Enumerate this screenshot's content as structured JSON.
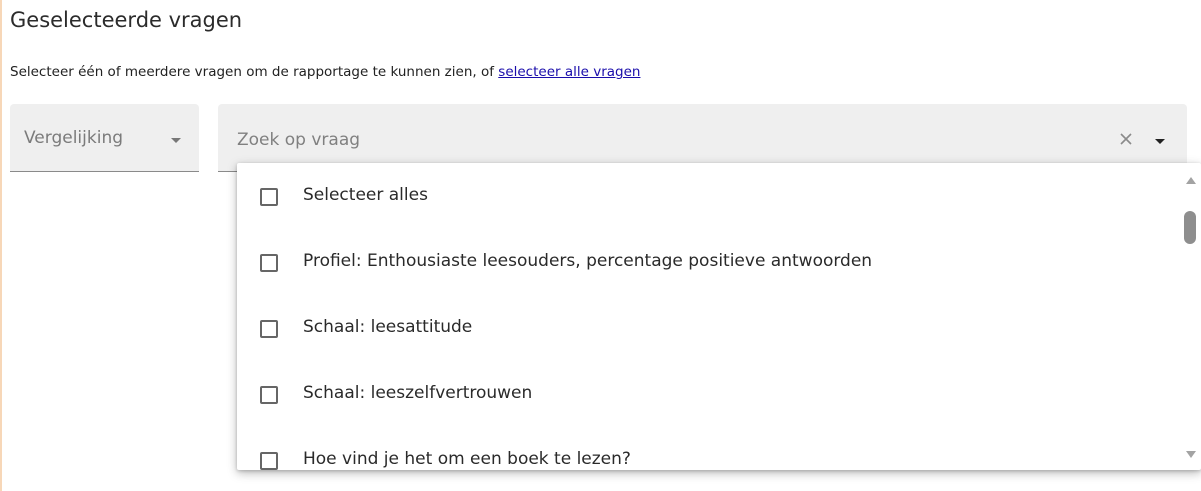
{
  "section": {
    "title": "Geselecteerde vragen",
    "instruction": "Selecteer één of meerdere vragen om de rapportage te kunnen zien, of ",
    "select_all_link": "selecteer alle vragen"
  },
  "compare_select": {
    "label": "Vergelijking"
  },
  "search": {
    "placeholder": "Zoek op vraag",
    "value": ""
  },
  "dropdown": {
    "items": [
      {
        "label": "Selecteer alles",
        "checked": false
      },
      {
        "label": "Profiel: Enthousiaste leesouders, percentage positieve antwoorden",
        "checked": false
      },
      {
        "label": "Schaal: leesattitude",
        "checked": false
      },
      {
        "label": "Schaal: leeszelfvertrouwen",
        "checked": false
      },
      {
        "label": "Hoe vind je het om een boek te lezen?",
        "checked": false
      }
    ]
  },
  "icons": {
    "clear": "close-icon",
    "dropdown": "chevron-down-icon",
    "scroll_up": "arrow-up-icon",
    "scroll_down": "arrow-down-icon"
  },
  "colors": {
    "link": "#1a0dab",
    "field_background": "#efefef",
    "accent_border": "#f7d7b8"
  }
}
